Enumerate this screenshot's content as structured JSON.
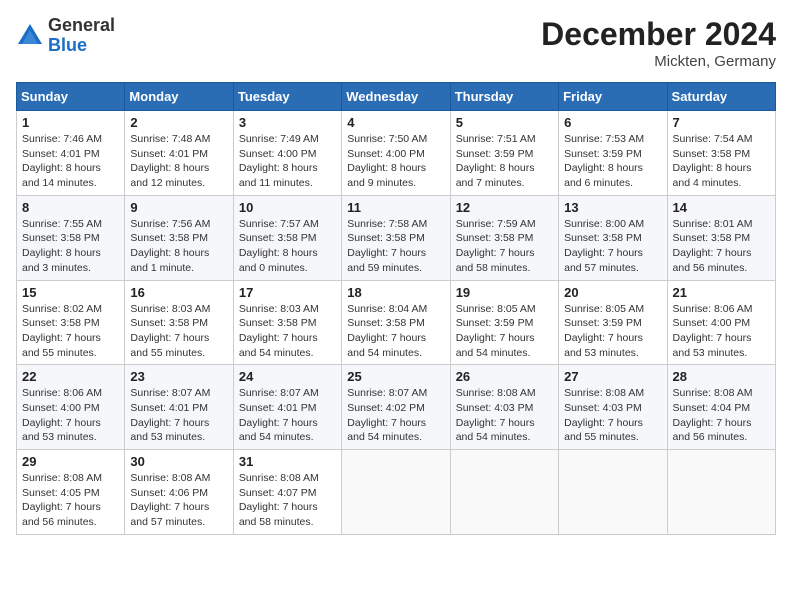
{
  "header": {
    "logo_line1": "General",
    "logo_line2": "Blue",
    "month": "December 2024",
    "location": "Mickten, Germany"
  },
  "weekdays": [
    "Sunday",
    "Monday",
    "Tuesday",
    "Wednesday",
    "Thursday",
    "Friday",
    "Saturday"
  ],
  "weeks": [
    [
      {
        "day": "1",
        "sunrise": "7:46 AM",
        "sunset": "4:01 PM",
        "daylight": "8 hours and 14 minutes."
      },
      {
        "day": "2",
        "sunrise": "7:48 AM",
        "sunset": "4:01 PM",
        "daylight": "8 hours and 12 minutes."
      },
      {
        "day": "3",
        "sunrise": "7:49 AM",
        "sunset": "4:00 PM",
        "daylight": "8 hours and 11 minutes."
      },
      {
        "day": "4",
        "sunrise": "7:50 AM",
        "sunset": "4:00 PM",
        "daylight": "8 hours and 9 minutes."
      },
      {
        "day": "5",
        "sunrise": "7:51 AM",
        "sunset": "3:59 PM",
        "daylight": "8 hours and 7 minutes."
      },
      {
        "day": "6",
        "sunrise": "7:53 AM",
        "sunset": "3:59 PM",
        "daylight": "8 hours and 6 minutes."
      },
      {
        "day": "7",
        "sunrise": "7:54 AM",
        "sunset": "3:58 PM",
        "daylight": "8 hours and 4 minutes."
      }
    ],
    [
      {
        "day": "8",
        "sunrise": "7:55 AM",
        "sunset": "3:58 PM",
        "daylight": "8 hours and 3 minutes."
      },
      {
        "day": "9",
        "sunrise": "7:56 AM",
        "sunset": "3:58 PM",
        "daylight": "8 hours and 1 minute."
      },
      {
        "day": "10",
        "sunrise": "7:57 AM",
        "sunset": "3:58 PM",
        "daylight": "8 hours and 0 minutes."
      },
      {
        "day": "11",
        "sunrise": "7:58 AM",
        "sunset": "3:58 PM",
        "daylight": "7 hours and 59 minutes."
      },
      {
        "day": "12",
        "sunrise": "7:59 AM",
        "sunset": "3:58 PM",
        "daylight": "7 hours and 58 minutes."
      },
      {
        "day": "13",
        "sunrise": "8:00 AM",
        "sunset": "3:58 PM",
        "daylight": "7 hours and 57 minutes."
      },
      {
        "day": "14",
        "sunrise": "8:01 AM",
        "sunset": "3:58 PM",
        "daylight": "7 hours and 56 minutes."
      }
    ],
    [
      {
        "day": "15",
        "sunrise": "8:02 AM",
        "sunset": "3:58 PM",
        "daylight": "7 hours and 55 minutes."
      },
      {
        "day": "16",
        "sunrise": "8:03 AM",
        "sunset": "3:58 PM",
        "daylight": "7 hours and 55 minutes."
      },
      {
        "day": "17",
        "sunrise": "8:03 AM",
        "sunset": "3:58 PM",
        "daylight": "7 hours and 54 minutes."
      },
      {
        "day": "18",
        "sunrise": "8:04 AM",
        "sunset": "3:58 PM",
        "daylight": "7 hours and 54 minutes."
      },
      {
        "day": "19",
        "sunrise": "8:05 AM",
        "sunset": "3:59 PM",
        "daylight": "7 hours and 54 minutes."
      },
      {
        "day": "20",
        "sunrise": "8:05 AM",
        "sunset": "3:59 PM",
        "daylight": "7 hours and 53 minutes."
      },
      {
        "day": "21",
        "sunrise": "8:06 AM",
        "sunset": "4:00 PM",
        "daylight": "7 hours and 53 minutes."
      }
    ],
    [
      {
        "day": "22",
        "sunrise": "8:06 AM",
        "sunset": "4:00 PM",
        "daylight": "7 hours and 53 minutes."
      },
      {
        "day": "23",
        "sunrise": "8:07 AM",
        "sunset": "4:01 PM",
        "daylight": "7 hours and 53 minutes."
      },
      {
        "day": "24",
        "sunrise": "8:07 AM",
        "sunset": "4:01 PM",
        "daylight": "7 hours and 54 minutes."
      },
      {
        "day": "25",
        "sunrise": "8:07 AM",
        "sunset": "4:02 PM",
        "daylight": "7 hours and 54 minutes."
      },
      {
        "day": "26",
        "sunrise": "8:08 AM",
        "sunset": "4:03 PM",
        "daylight": "7 hours and 54 minutes."
      },
      {
        "day": "27",
        "sunrise": "8:08 AM",
        "sunset": "4:03 PM",
        "daylight": "7 hours and 55 minutes."
      },
      {
        "day": "28",
        "sunrise": "8:08 AM",
        "sunset": "4:04 PM",
        "daylight": "7 hours and 56 minutes."
      }
    ],
    [
      {
        "day": "29",
        "sunrise": "8:08 AM",
        "sunset": "4:05 PM",
        "daylight": "7 hours and 56 minutes."
      },
      {
        "day": "30",
        "sunrise": "8:08 AM",
        "sunset": "4:06 PM",
        "daylight": "7 hours and 57 minutes."
      },
      {
        "day": "31",
        "sunrise": "8:08 AM",
        "sunset": "4:07 PM",
        "daylight": "7 hours and 58 minutes."
      },
      null,
      null,
      null,
      null
    ]
  ]
}
